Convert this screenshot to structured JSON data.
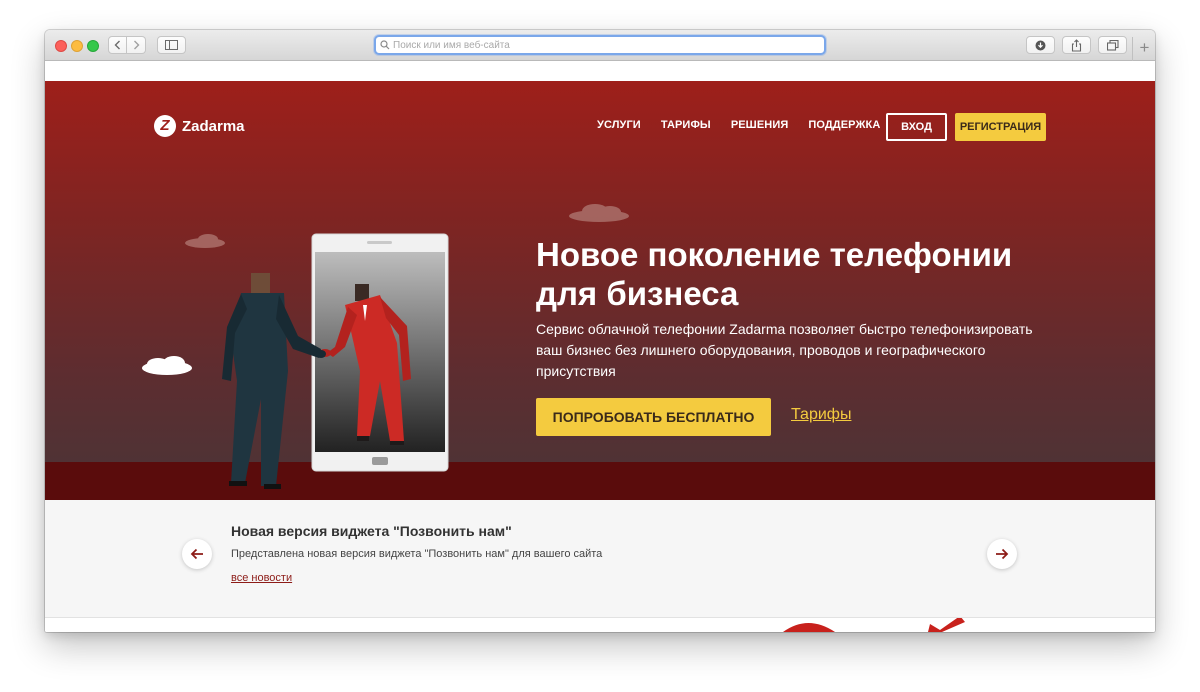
{
  "browser": {
    "address_placeholder": "Поиск или имя веб-сайта",
    "new_tab_label": "+"
  },
  "site": {
    "logo_text": "Zadarma",
    "nav": [
      "УСЛУГИ",
      "ТАРИФЫ",
      "РЕШЕНИЯ",
      "ПОДДЕРЖКА"
    ],
    "login_label": "ВХОД",
    "register_label": "РЕГИСТРАЦИЯ"
  },
  "hero": {
    "title_line1": "Новое поколение телефонии",
    "title_line2": "для бизнеса",
    "description": "Сервис облачной телефонии Zadarma позволяет быстро телефонизировать ваш бизнес без лишнего оборудования, проводов и географического присутствия",
    "cta_label": "ПОПРОБОВАТЬ БЕСПЛАТНО",
    "tariffs_link": "Тарифы"
  },
  "news": {
    "title": "Новая версия виджета \"Позвонить нам\"",
    "text": "Представлена новая версия виджета \"Позвонить нам\" для вашего сайта",
    "all_link": "все новости"
  },
  "colors": {
    "brand_red": "#9e1f1a",
    "accent_yellow": "#f4cb3f",
    "ground": "#5a0c0c",
    "address_focus": "#7aa7ea"
  },
  "icons": {
    "traffic_lights": [
      "close-light",
      "minimize-light",
      "zoom-light"
    ],
    "toolbar": [
      "back-icon",
      "forward-icon",
      "sidebar-icon",
      "search-icon",
      "download-icon",
      "share-icon",
      "tabs-icon"
    ],
    "news_arrows": [
      "arrow-left-icon",
      "arrow-right-icon"
    ]
  }
}
